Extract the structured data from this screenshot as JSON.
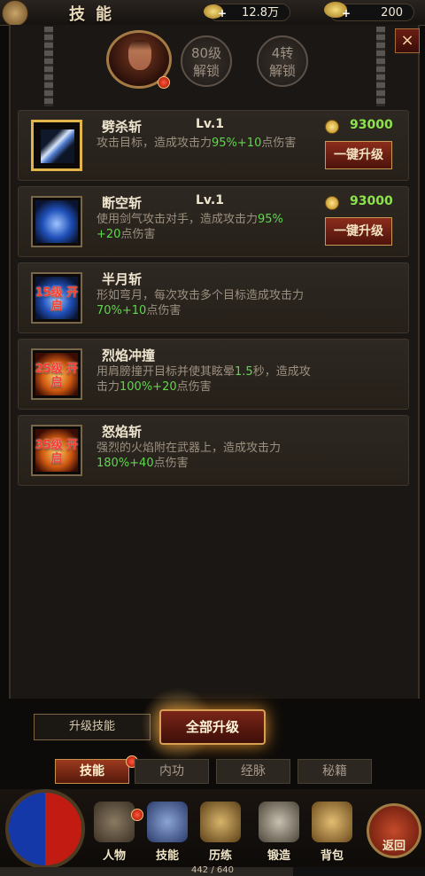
{
  "header": {
    "title": "技能",
    "gold": "12.8万",
    "ingot": "200"
  },
  "unlocks": [
    {
      "line1": "80级",
      "line2": "解锁"
    },
    {
      "line1": "4转",
      "line2": "解锁"
    }
  ],
  "close_label": "×",
  "skills": [
    {
      "name": "劈杀斩",
      "level": "Lv.1",
      "desc_a": "攻击目标，造成攻击力",
      "desc_g1": "95%+10",
      "desc_b": "点伤害",
      "desc_g2": "",
      "desc_c": "",
      "cost": "93000",
      "button": "一键升级"
    },
    {
      "name": "断空斩",
      "level": "Lv.1",
      "desc_a": "使用剑气攻击对手，造成攻击力",
      "desc_g1": "95%",
      "desc_b": "",
      "desc_g2": "+20",
      "desc_c": "点伤害",
      "cost": "93000",
      "button": "一键升级"
    },
    {
      "name": "半月斩",
      "lock": "15级 开启",
      "desc_a": "形如弯月，每次攻击多个目标造成攻击力",
      "desc_g1": "70%+10",
      "desc_b": "点伤害"
    },
    {
      "name": "烈焰冲撞",
      "lock": "25级 开启",
      "desc_a": "用肩膀撞开目标并使其眩晕",
      "desc_g1": "1.5",
      "desc_b": "秒，造成攻击力",
      "desc_g2": "100%+20",
      "desc_c": "点伤害"
    },
    {
      "name": "怒焰斩",
      "lock": "35级 开启",
      "desc_a": "强烈的火焰附在武器上，造成攻击力",
      "desc_g1": "180%+40",
      "desc_b": "点伤害"
    }
  ],
  "actions": {
    "upgrade_skill": "升级技能",
    "upgrade_all": "全部升级"
  },
  "tabs": [
    "技能",
    "内功",
    "经脉",
    "秘籍"
  ],
  "nav": [
    "人物",
    "技能",
    "历练",
    "锻造",
    "背包"
  ],
  "back_label": "返回",
  "progress": {
    "text": "442 / 640",
    "fraction": 0.69
  }
}
